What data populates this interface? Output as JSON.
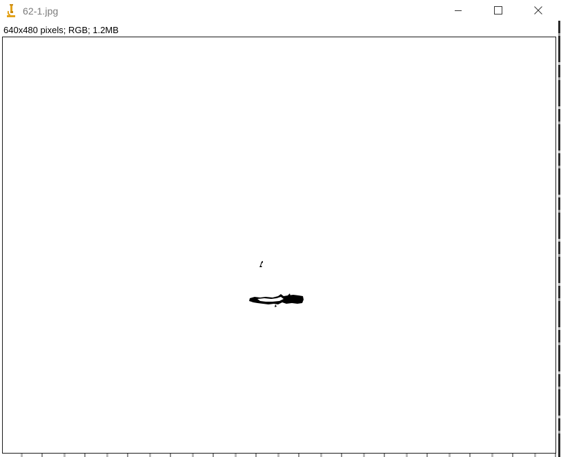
{
  "window": {
    "title": "62-1.jpg",
    "icon": "microscope-icon",
    "controls": {
      "minimize_icon": "minimize-icon",
      "maximize_icon": "maximize-icon",
      "close_icon": "close-icon"
    }
  },
  "status": {
    "info": "640x480 pixels; RGB; 1.2MB"
  },
  "colors": {
    "icon_accent": "#e3a21a",
    "title_text": "#7a7a7a",
    "frame_border": "#1a1a1a"
  }
}
